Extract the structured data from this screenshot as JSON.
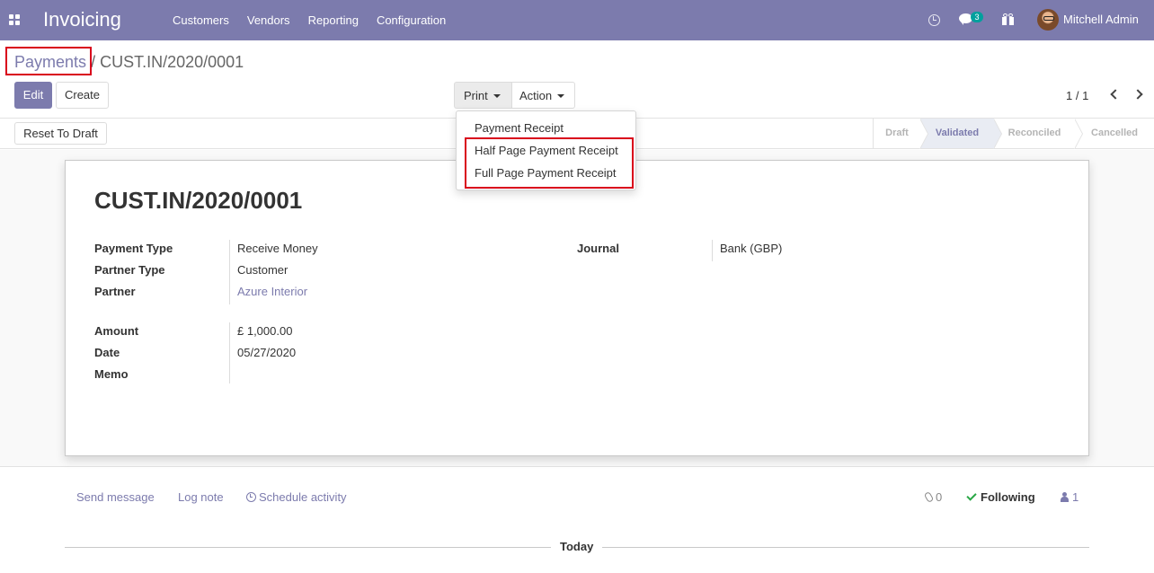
{
  "navbar": {
    "app_title": "Invoicing",
    "menu": [
      "Customers",
      "Vendors",
      "Reporting",
      "Configuration"
    ],
    "messages_badge": "3",
    "user_name": "Mitchell Admin"
  },
  "breadcrumb": {
    "parent": "Payments",
    "separator": "/",
    "current": "CUST.IN/2020/0001"
  },
  "toolbar": {
    "edit_label": "Edit",
    "create_label": "Create",
    "print_label": "Print",
    "action_label": "Action",
    "pager": "1 / 1"
  },
  "print_menu": {
    "items": [
      "Payment Receipt",
      "Half Page Payment Receipt",
      "Full Page Payment Receipt"
    ]
  },
  "statusbar": {
    "reset_label": "Reset To Draft",
    "steps": [
      "Draft",
      "Validated",
      "Reconciled",
      "Cancelled"
    ],
    "active_step": "Validated"
  },
  "form": {
    "title": "CUST.IN/2020/0001",
    "payment_type_label": "Payment Type",
    "payment_type": "Receive Money",
    "partner_type_label": "Partner Type",
    "partner_type": "Customer",
    "partner_label": "Partner",
    "partner": "Azure Interior",
    "journal_label": "Journal",
    "journal": "Bank (GBP)",
    "amount_label": "Amount",
    "amount": "£ 1,000.00",
    "date_label": "Date",
    "date": "05/27/2020",
    "memo_label": "Memo"
  },
  "chatter": {
    "send_message": "Send message",
    "log_note": "Log note",
    "schedule_activity": "Schedule activity",
    "attachments": "0",
    "following": "Following",
    "followers": "1",
    "today": "Today"
  },
  "colors": {
    "brand": "#7c7bad",
    "highlight": "#d9001b",
    "following": "#28a745"
  }
}
